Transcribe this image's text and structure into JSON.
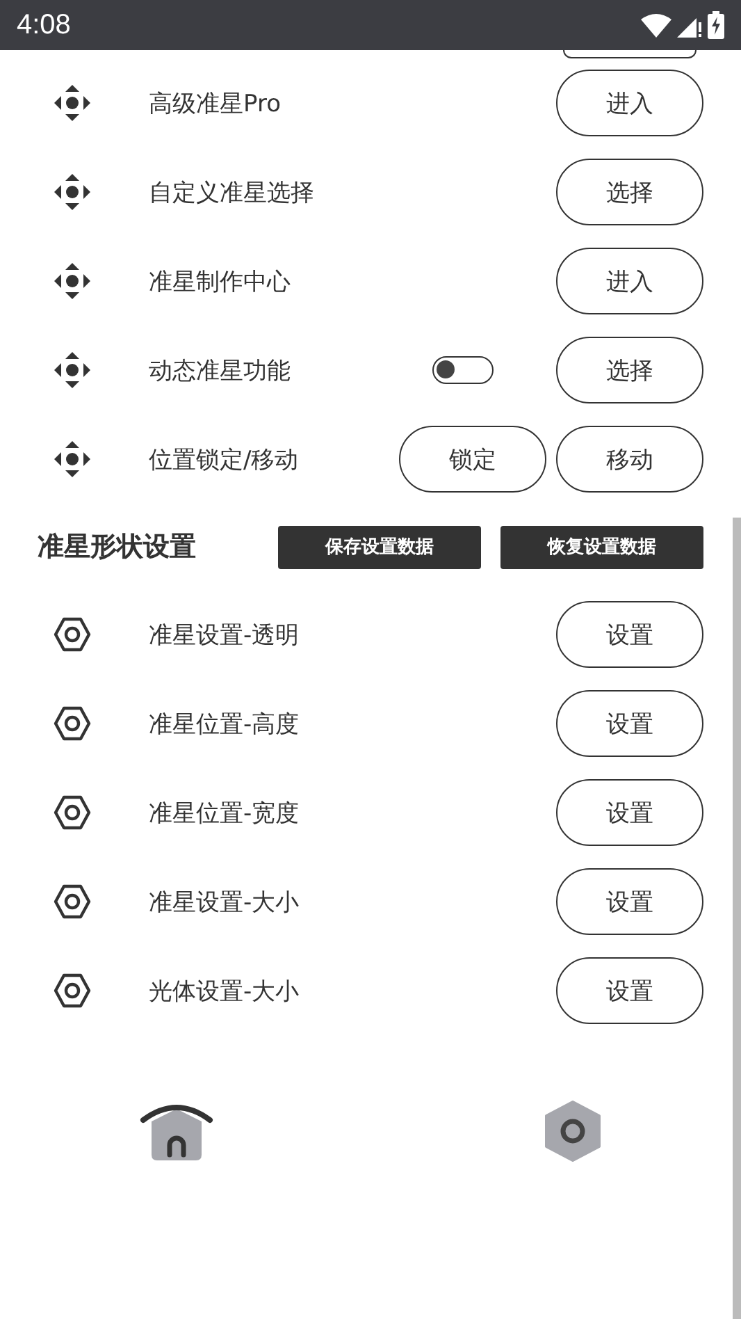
{
  "status_bar": {
    "time": "4:08"
  },
  "aim_rows": [
    {
      "label": "高级准星Pro",
      "kind": "button",
      "buttons": [
        "进入"
      ]
    },
    {
      "label": "自定义准星选择",
      "kind": "button",
      "buttons": [
        "选择"
      ]
    },
    {
      "label": "准星制作中心",
      "kind": "button",
      "buttons": [
        "进入"
      ]
    },
    {
      "label": "动态准星功能",
      "kind": "toggle",
      "on": false,
      "buttons": [
        "选择"
      ]
    },
    {
      "label": "位置锁定/移动",
      "kind": "button",
      "buttons": [
        "锁定",
        "移动"
      ]
    }
  ],
  "shape_section": {
    "title": "准星形状设置",
    "actions": [
      "保存设置数据",
      "恢复设置数据"
    ],
    "rows": [
      {
        "label": "准星设置-透明",
        "button": "设置"
      },
      {
        "label": "准星位置-高度",
        "button": "设置"
      },
      {
        "label": "准星位置-宽度",
        "button": "设置"
      },
      {
        "label": "准星设置-大小",
        "button": "设置"
      },
      {
        "label": "光体设置-大小",
        "button": "设置"
      }
    ]
  },
  "bottom_nav": [
    {
      "kind": "home",
      "selected": true
    },
    {
      "kind": "settings",
      "selected": false
    }
  ]
}
